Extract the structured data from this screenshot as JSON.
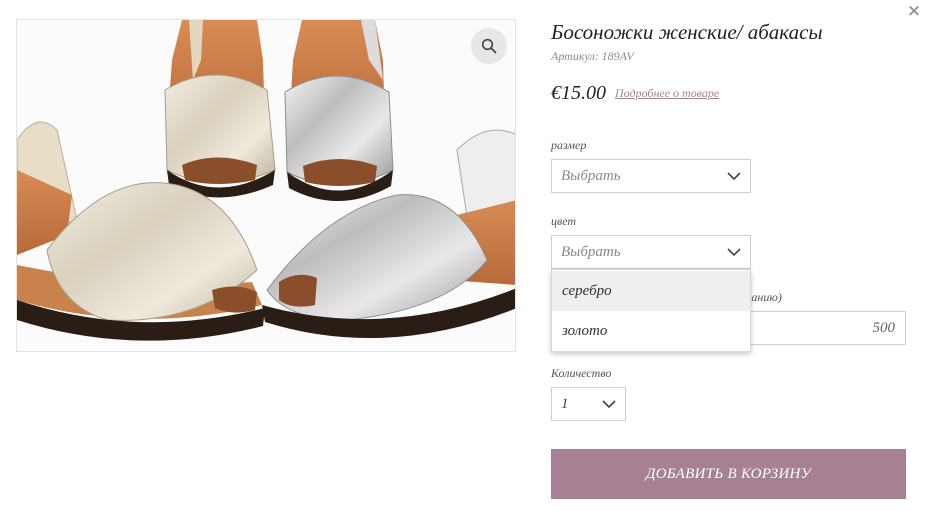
{
  "modal": {
    "close_label": "×"
  },
  "product": {
    "title": "Босоножки женские/ абакасы",
    "sku": "Артикул: 189AV",
    "price": "€15.00",
    "more_link": "Подробнее о товаре"
  },
  "image": {
    "alt_subject": "women's silver and gold abarca sandals",
    "zoom_icon": "search-icon"
  },
  "options": {
    "size": {
      "label": "размер",
      "selected": "Выбрать"
    },
    "color": {
      "label": "цвет",
      "selected": "Выбрать",
      "expanded": true,
      "options": [
        "серебро",
        "золото"
      ],
      "highlighted_option": "серебро"
    },
    "amount": {
      "label_fragment": "желанию)",
      "value": "500"
    },
    "quantity": {
      "label": "Количество",
      "selected": "1"
    }
  },
  "actions": {
    "add_to_cart_label": "Добавить в корзину"
  },
  "colors": {
    "accent": "#a68093",
    "link": "#a67f92",
    "border": "#cfcfcf",
    "text": "#222222"
  }
}
